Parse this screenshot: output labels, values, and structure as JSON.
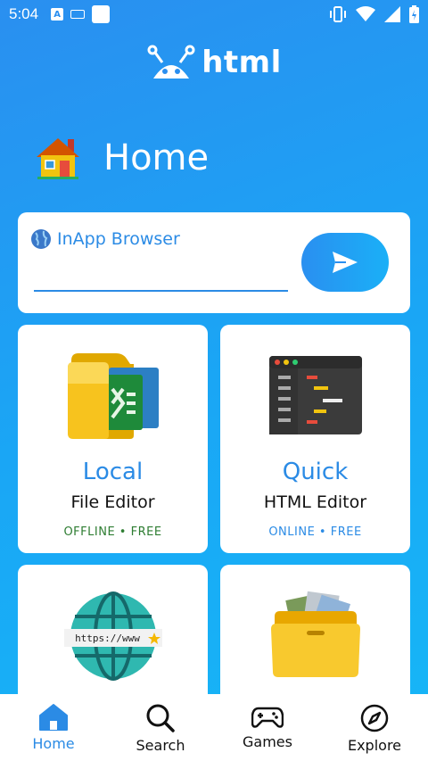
{
  "status": {
    "time": "5:04"
  },
  "brand": {
    "name": "html"
  },
  "header": {
    "title": "Home"
  },
  "browser": {
    "label": "InApp Browser",
    "placeholder": ""
  },
  "tiles": [
    {
      "title": "Local",
      "subtitle": "File Editor",
      "tag": "OFFLINE • FREE",
      "tag_color": "#2e7d32"
    },
    {
      "title": "Quick",
      "subtitle": "HTML Editor",
      "tag": "ONLINE • FREE",
      "tag_color": "#2b8be5"
    },
    {
      "globe_text": "https://www"
    }
  ],
  "nav": [
    {
      "label": "Home",
      "icon": "home-icon",
      "active": true
    },
    {
      "label": "Search",
      "icon": "search-icon"
    },
    {
      "label": "Games",
      "icon": "gamepad-icon"
    },
    {
      "label": "Explore",
      "icon": "compass-icon"
    }
  ],
  "colors": {
    "accent": "#2b8be5",
    "gradient_start": "#2a8ff0",
    "gradient_end": "#16b7f7"
  }
}
